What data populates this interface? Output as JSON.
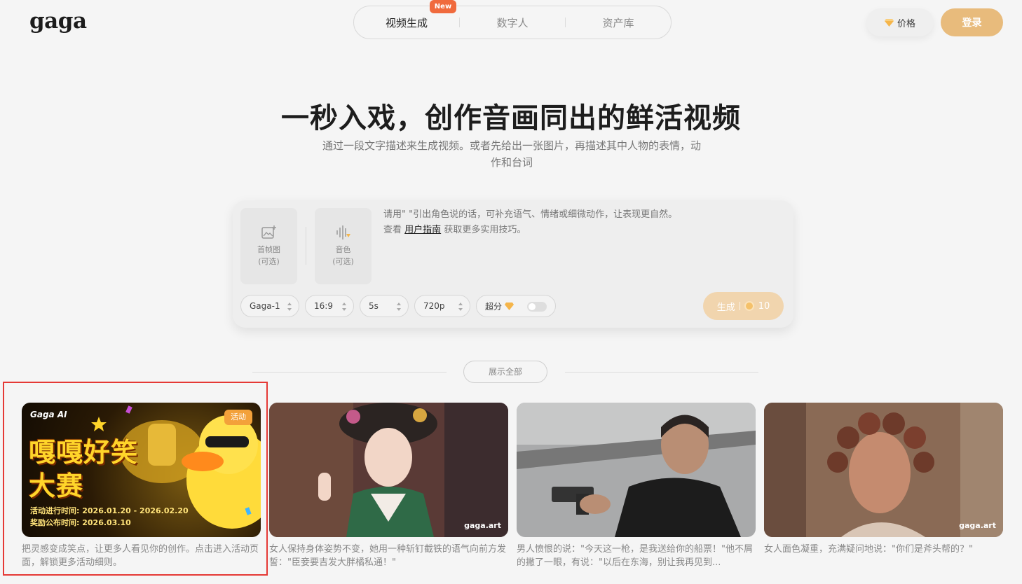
{
  "header": {
    "logo": "gaga",
    "nav_tabs": [
      {
        "label": "视频生成",
        "active": true
      },
      {
        "label": "数字人",
        "active": false
      },
      {
        "label": "资产库",
        "active": false
      }
    ],
    "new_badge": "New",
    "price_label": "价格",
    "login_label": "登录"
  },
  "hero": {
    "title": "一秒入戏，创作音画同出的鲜活视频",
    "subtitle": "通过一段文字描述来生成视频。或者先给出一张图片，再描述其中人物的表情，动作和台词"
  },
  "composer": {
    "first_frame": {
      "label": "首帧图",
      "note": "(可选)"
    },
    "voice": {
      "label": "音色",
      "note": "(可选)"
    },
    "hint_line1": "请用\" \"引出角色说的话，可补充语气、情绪或细微动作，让表现更自然。",
    "hint_prefix": "查看",
    "hint_link": "用户指南",
    "hint_suffix": "获取更多实用技巧。",
    "options": {
      "model": "Gaga-1",
      "ratio": "16:9",
      "duration": "5s",
      "resolution": "720p",
      "hd_label": "超分"
    },
    "generate_label": "生成",
    "cost": "10"
  },
  "show_all_label": "展示全部",
  "gallery": [
    {
      "brand": "Gaga AI",
      "tag": "活动",
      "title_line1": "嘎嘎好笑",
      "title_line2": "大赛",
      "period": "活动进行时间: 2026.01.20 - 2026.02.20",
      "announce": "奖励公布时间: 2026.03.10",
      "caption": "把灵感变成笑点，让更多人看见你的创作。点击进入活动页面，解锁更多活动细则。"
    },
    {
      "watermark": "gaga.art",
      "caption": "女人保持身体姿势不变，她用一种斩钉截铁的语气向前方发誓：\"臣妾要吉发大胖橘私通！\""
    },
    {
      "caption": "男人愤恨的说：\"今天这一枪，是我送给你的船票！\"他不屑的撇了一眼，有说：\"以后在东海，别让我再见到..."
    },
    {
      "watermark": "gaga.art",
      "caption": "女人面色凝重，充满疑问地说：\"你们是斧头帮的？\""
    }
  ]
}
